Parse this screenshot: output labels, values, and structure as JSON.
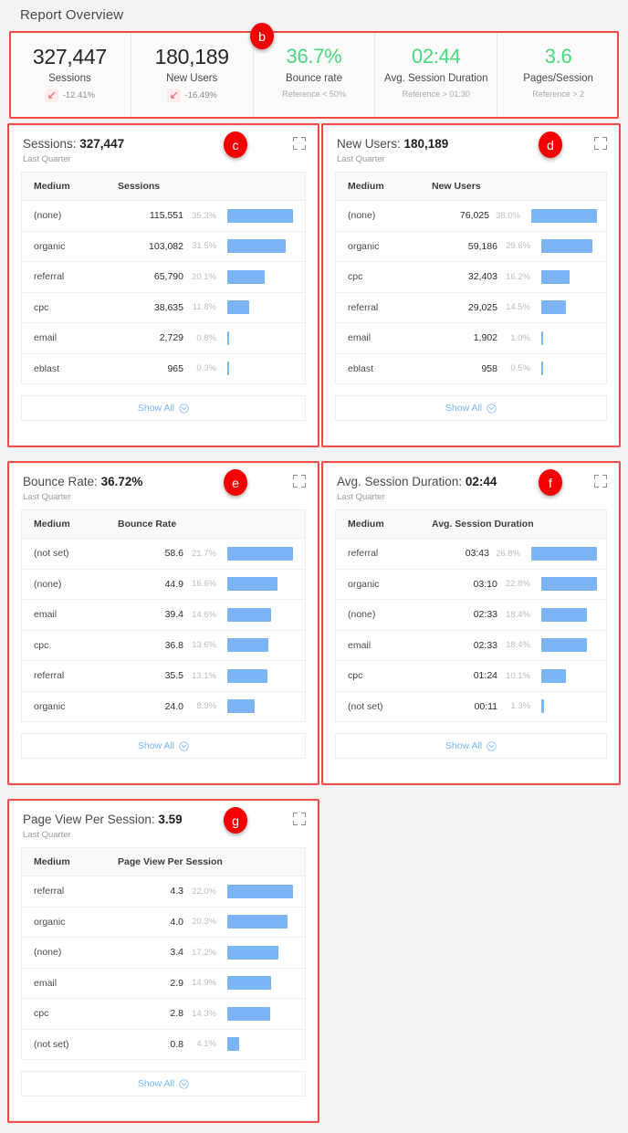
{
  "page": {
    "title": "Report Overview"
  },
  "annotations": [
    {
      "id": "b",
      "label": "b"
    },
    {
      "id": "c",
      "label": "c"
    },
    {
      "id": "d",
      "label": "d"
    },
    {
      "id": "e",
      "label": "e"
    },
    {
      "id": "f",
      "label": "f"
    },
    {
      "id": "g",
      "label": "g"
    }
  ],
  "colors": {
    "accent_blue": "#7cb5f5",
    "good_green": "#4ad87c",
    "annotation_red": "#f50000",
    "outline_red": "#ef4b4b",
    "link_blue": "#74b9f7"
  },
  "kpis": [
    {
      "value": "327,447",
      "label": "Sessions",
      "delta": "-12.41%",
      "delta_icon": "arrow-down-left-icon",
      "reference": ""
    },
    {
      "value": "180,189",
      "label": "New Users",
      "delta": "-16.49%",
      "delta_icon": "arrow-down-left-icon",
      "reference": ""
    },
    {
      "value": "36.7%",
      "label": "Bounce rate",
      "delta": "",
      "reference": "Reference < 50%"
    },
    {
      "value": "02:44",
      "label": "Avg. Session Duration",
      "delta": "",
      "reference": "Reference > 01:30"
    },
    {
      "value": "3.6",
      "label": "Pages/Session",
      "delta": "",
      "reference": "Reference > 2"
    }
  ],
  "common": {
    "subtitle": "Last Quarter",
    "medium_header": "Medium",
    "show_all": "Show All",
    "expand_icon": "expand-icon",
    "chevron_icon": "chevron-down-circle-icon"
  },
  "cards": [
    {
      "title_prefix": "Sessions: ",
      "title_value": "327,447",
      "subtitle": "Last Quarter",
      "metric_header": "Sessions",
      "rows": [
        {
          "medium": "(none)",
          "value": "115,551",
          "pct": "35.3%",
          "bar": 100
        },
        {
          "medium": "organic",
          "value": "103,082",
          "pct": "31.5%",
          "bar": 89
        },
        {
          "medium": "referral",
          "value": "65,790",
          "pct": "20.1%",
          "bar": 57
        },
        {
          "medium": "cpc",
          "value": "38,635",
          "pct": "11.8%",
          "bar": 33
        },
        {
          "medium": "email",
          "value": "2,729",
          "pct": "0.8%",
          "bar": 2
        },
        {
          "medium": "eblast",
          "value": "965",
          "pct": "0.3%",
          "bar": 1
        }
      ]
    },
    {
      "title_prefix": "New Users: ",
      "title_value": "180,189",
      "subtitle": "Last Quarter",
      "metric_header": "New Users",
      "rows": [
        {
          "medium": "(none)",
          "value": "76,025",
          "pct": "38.0%",
          "bar": 100
        },
        {
          "medium": "organic",
          "value": "59,186",
          "pct": "29.6%",
          "bar": 78
        },
        {
          "medium": "cpc",
          "value": "32,403",
          "pct": "16.2%",
          "bar": 43
        },
        {
          "medium": "referral",
          "value": "29,025",
          "pct": "14.5%",
          "bar": 38
        },
        {
          "medium": "email",
          "value": "1,902",
          "pct": "1.0%",
          "bar": 2
        },
        {
          "medium": "eblast",
          "value": "958",
          "pct": "0.5%",
          "bar": 1
        }
      ]
    },
    {
      "title_prefix": "Bounce Rate: ",
      "title_value": "36.72%",
      "subtitle": "Last Quarter",
      "metric_header": "Bounce Rate",
      "rows": [
        {
          "medium": "(not set)",
          "value": "58.6",
          "pct": "21.7%",
          "bar": 100
        },
        {
          "medium": "(none)",
          "value": "44.9",
          "pct": "16.6%",
          "bar": 77
        },
        {
          "medium": "email",
          "value": "39.4",
          "pct": "14.6%",
          "bar": 67
        },
        {
          "medium": "cpc",
          "value": "36.8",
          "pct": "13.6%",
          "bar": 63
        },
        {
          "medium": "referral",
          "value": "35.5",
          "pct": "13.1%",
          "bar": 61
        },
        {
          "medium": "organic",
          "value": "24.0",
          "pct": "8.9%",
          "bar": 41
        }
      ]
    },
    {
      "title_prefix": "Avg. Session Duration: ",
      "title_value": "02:44",
      "subtitle": "Last Quarter",
      "metric_header": "Avg. Session Duration",
      "rows": [
        {
          "medium": "referral",
          "value": "03:43",
          "pct": "26.8%",
          "bar": 100
        },
        {
          "medium": "organic",
          "value": "03:10",
          "pct": "22.8%",
          "bar": 85
        },
        {
          "medium": "(none)",
          "value": "02:33",
          "pct": "18.4%",
          "bar": 69
        },
        {
          "medium": "email",
          "value": "02:33",
          "pct": "18.4%",
          "bar": 69
        },
        {
          "medium": "cpc",
          "value": "01:24",
          "pct": "10.1%",
          "bar": 38
        },
        {
          "medium": "(not set)",
          "value": "00:11",
          "pct": "1.3%",
          "bar": 4
        }
      ]
    },
    {
      "title_prefix": "Page View Per Session: ",
      "title_value": "3.59",
      "subtitle": "Last Quarter",
      "metric_header": "Page View Per Session",
      "rows": [
        {
          "medium": "referral",
          "value": "4.3",
          "pct": "22.0%",
          "bar": 100
        },
        {
          "medium": "organic",
          "value": "4.0",
          "pct": "20.3%",
          "bar": 92
        },
        {
          "medium": "(none)",
          "value": "3.4",
          "pct": "17.2%",
          "bar": 78
        },
        {
          "medium": "email",
          "value": "2.9",
          "pct": "14.9%",
          "bar": 67
        },
        {
          "medium": "cpc",
          "value": "2.8",
          "pct": "14.3%",
          "bar": 65
        },
        {
          "medium": "(not set)",
          "value": "0.8",
          "pct": "4.1%",
          "bar": 18
        }
      ]
    }
  ],
  "chart_data": [
    {
      "type": "bar",
      "title": "Sessions: 327,447",
      "subtitle": "Last Quarter",
      "xlabel": "Medium",
      "ylabel": "Sessions",
      "grid": false,
      "legend": "none",
      "categories": [
        "(none)",
        "organic",
        "referral",
        "cpc",
        "email",
        "eblast"
      ],
      "values": [
        115551,
        103082,
        65790,
        38635,
        2729,
        965
      ],
      "share_pct": [
        35.3,
        31.5,
        20.1,
        11.8,
        0.8,
        0.3
      ]
    },
    {
      "type": "bar",
      "title": "New Users: 180,189",
      "subtitle": "Last Quarter",
      "xlabel": "Medium",
      "ylabel": "New Users",
      "grid": false,
      "legend": "none",
      "categories": [
        "(none)",
        "organic",
        "cpc",
        "referral",
        "email",
        "eblast"
      ],
      "values": [
        76025,
        59186,
        32403,
        29025,
        1902,
        958
      ],
      "share_pct": [
        38.0,
        29.6,
        16.2,
        14.5,
        1.0,
        0.5
      ]
    },
    {
      "type": "bar",
      "title": "Bounce Rate: 36.72%",
      "subtitle": "Last Quarter",
      "xlabel": "Medium",
      "ylabel": "Bounce Rate",
      "grid": false,
      "legend": "none",
      "categories": [
        "(not set)",
        "(none)",
        "email",
        "cpc",
        "referral",
        "organic"
      ],
      "values": [
        58.6,
        44.9,
        39.4,
        36.8,
        35.5,
        24.0
      ],
      "share_pct": [
        21.7,
        16.6,
        14.6,
        13.6,
        13.1,
        8.9
      ]
    },
    {
      "type": "bar",
      "title": "Avg. Session Duration: 02:44",
      "subtitle": "Last Quarter",
      "xlabel": "Medium",
      "ylabel": "Avg. Session Duration",
      "grid": false,
      "legend": "none",
      "categories": [
        "referral",
        "organic",
        "(none)",
        "email",
        "cpc",
        "(not set)"
      ],
      "values": [
        "03:43",
        "03:10",
        "02:33",
        "02:33",
        "01:24",
        "00:11"
      ],
      "share_pct": [
        26.8,
        22.8,
        18.4,
        18.4,
        10.1,
        1.3
      ]
    },
    {
      "type": "bar",
      "title": "Page View Per Session: 3.59",
      "subtitle": "Last Quarter",
      "xlabel": "Medium",
      "ylabel": "Page View Per Session",
      "grid": false,
      "legend": "none",
      "categories": [
        "referral",
        "organic",
        "(none)",
        "email",
        "cpc",
        "(not set)"
      ],
      "values": [
        4.3,
        4.0,
        3.4,
        2.9,
        2.8,
        0.8
      ],
      "share_pct": [
        22.0,
        20.3,
        17.2,
        14.9,
        14.3,
        4.1
      ]
    }
  ]
}
